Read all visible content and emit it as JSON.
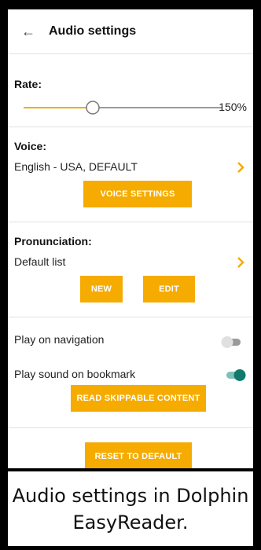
{
  "header": {
    "title": "Audio settings",
    "back_icon": "arrow-left-icon"
  },
  "rate": {
    "label": "Rate:",
    "value_text": "150%",
    "slider_fraction": 0.35
  },
  "voice": {
    "label": "Voice:",
    "value": "English - USA, DEFAULT",
    "button": "VOICE SETTINGS"
  },
  "pronunciation": {
    "label": "Pronunciation:",
    "value": "Default list",
    "new_button": "NEW",
    "edit_button": "EDIT"
  },
  "toggles": {
    "play_on_navigation": {
      "label": "Play on navigation",
      "on": false
    },
    "play_sound_on_bookmark": {
      "label": "Play sound on bookmark",
      "on": true
    },
    "read_skippable_button": "READ SKIPPABLE CONTENT"
  },
  "reset_button": "RESET TO DEFAULT",
  "caption": "Audio settings in Dolphin EasyReader.",
  "colors": {
    "accent": "#F6AB00",
    "toggle_on": "#0F7A6B",
    "toggle_off": "#D4D4D4"
  }
}
